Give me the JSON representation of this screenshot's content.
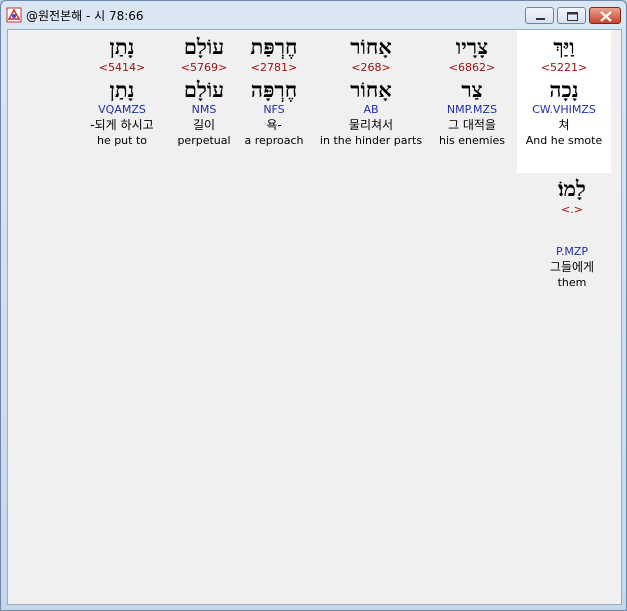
{
  "window": {
    "title": "@원전본해 - 시 78:66"
  },
  "words": [
    {
      "hebrew": "וַיַּךְ",
      "strong": "<5221>",
      "lemma": "נָכָה",
      "parsing": "CW.VHIMZS",
      "korean": "쳐",
      "english": "And he smote"
    },
    {
      "hebrew": "צָרָיו",
      "strong": "<6862>",
      "lemma": "צַר",
      "parsing": "NMP.MZS",
      "korean": "그 대적을",
      "english": "his enemies"
    },
    {
      "hebrew": "אָחוֹר",
      "strong": "<268>",
      "lemma": "אָחוֹר",
      "parsing": "AB",
      "korean": "물리쳐서",
      "english": "in the hinder parts"
    },
    {
      "hebrew": "חֶרְפַּת",
      "strong": "<2781>",
      "lemma": "חֶרְפָּה",
      "parsing": "NFS",
      "korean": "욕-",
      "english": "a reproach"
    },
    {
      "hebrew": "עוֹלָם",
      "strong": "<5769>",
      "lemma": "עוֹלָם",
      "parsing": "NMS",
      "korean": "길이",
      "english": "perpetual"
    },
    {
      "hebrew": "נָתַן",
      "strong": "<5414>",
      "lemma": "נָתַן",
      "parsing": "VQAMZS",
      "korean": "-되게 하시고",
      "english": "he put to"
    },
    {
      "hebrew": "לָמוֹ׃",
      "strong": "<.>",
      "lemma": "",
      "parsing": "P.MZP",
      "korean": "그들에게",
      "english": "them"
    }
  ]
}
